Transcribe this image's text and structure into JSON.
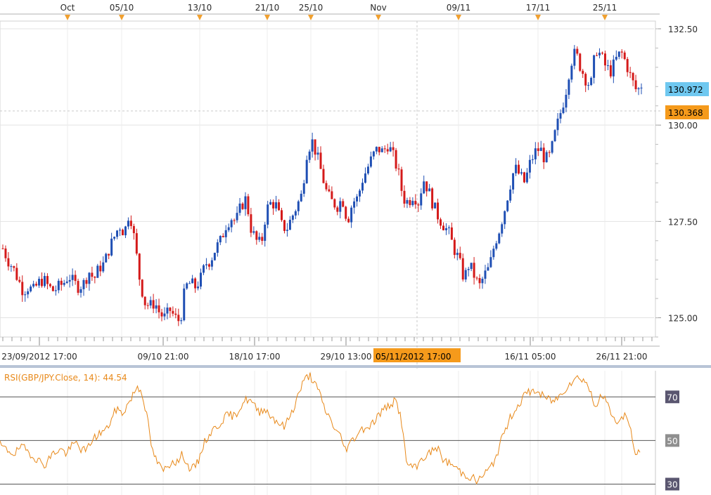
{
  "chart_data": [
    {
      "type": "candlestick",
      "symbol": "GBP/JPY",
      "ylim": [
        124.5,
        132.7
      ],
      "yticks": [
        "132.50",
        "130.00",
        "127.50",
        "125.00"
      ],
      "ytick_values": [
        132.5,
        130.0,
        127.5,
        125.0
      ],
      "top_date_labels": [
        "Oct",
        "05/10",
        "13/10",
        "21/10",
        "25/10",
        "Nov",
        "09/11",
        "17/11",
        "25/11"
      ],
      "bottom_date_labels": [
        "23/09/2012 17:00",
        "09/10 21:00",
        "18/10 17:00",
        "29/10 13:00",
        "16/11 05:00",
        "26/11 21:00"
      ],
      "last_price": "130.972",
      "crosshair_price": "130.368",
      "crosshair_date": "05/11/2012 17:00",
      "colors": {
        "up": "#1f4fb4",
        "down": "#d41a1a",
        "last_price_badge": "#6fc8f0",
        "crosshair_badge": "#f59a1b"
      },
      "close_path": [
        126.8,
        126.5,
        126.3,
        126.0,
        125.7,
        125.8,
        125.7,
        125.9,
        126.0,
        125.8,
        125.7,
        125.8,
        125.9,
        126.1,
        125.9,
        125.8,
        125.9,
        126.2,
        126.0,
        126.3,
        126.4,
        126.8,
        127.1,
        127.4,
        127.2,
        127.8,
        127.0,
        126.0,
        125.4,
        125.3,
        125.4,
        125.1,
        125.0,
        125.2,
        125.0,
        124.9,
        125.8,
        125.9,
        125.8,
        126.0,
        126.4,
        126.5,
        126.8,
        127.0,
        127.4,
        127.6,
        127.5,
        127.9,
        128.1,
        127.3,
        127.0,
        126.9,
        127.8,
        128.0,
        127.9,
        127.4,
        127.3,
        127.6,
        127.9,
        128.2,
        129.3,
        129.6,
        129.2,
        128.7,
        128.2,
        128.0,
        127.9,
        128.1,
        127.5,
        128.0,
        128.1,
        128.6,
        128.9,
        129.2,
        129.4,
        129.3,
        129.5,
        129.2,
        128.8,
        128.1,
        128.0,
        128.2,
        128.0,
        128.6,
        128.3,
        127.9,
        127.6,
        127.4,
        127.2,
        126.8,
        126.5,
        126.0,
        126.4,
        126.1,
        125.8,
        126.1,
        126.3,
        126.9,
        127.3,
        127.8,
        128.4,
        128.9,
        128.7,
        128.5,
        129.0,
        129.3,
        129.4,
        129.1,
        129.2,
        129.8,
        130.3,
        130.8,
        131.6,
        131.9,
        131.5,
        131.2,
        131.0,
        132.0,
        131.8,
        131.5,
        131.4,
        131.7,
        131.9,
        131.6,
        131.2,
        130.9,
        130.97
      ]
    },
    {
      "type": "line",
      "title": "RSI(GBP/JPY.Close, 14): 44.54",
      "ylim": [
        25,
        82
      ],
      "levels": [
        "70",
        "50",
        "30"
      ],
      "level_values": [
        70,
        50,
        30
      ],
      "colors": {
        "line": "#e8891a",
        "level_badge_70": "#5a5670",
        "level_badge_50": "#8f8f8f",
        "level_badge_30": "#5a5670"
      },
      "values": [
        48,
        46,
        45,
        44,
        47,
        46,
        44,
        42,
        40,
        39,
        43,
        45,
        46,
        44,
        47,
        49,
        46,
        45,
        50,
        52,
        54,
        55,
        60,
        65,
        62,
        66,
        70,
        75,
        72,
        60,
        45,
        40,
        36,
        38,
        41,
        40,
        44,
        38,
        37,
        40,
        48,
        52,
        55,
        57,
        60,
        62,
        61,
        64,
        68,
        69,
        66,
        63,
        65,
        62,
        60,
        58,
        56,
        61,
        66,
        73,
        78,
        80,
        76,
        71,
        64,
        60,
        55,
        52,
        46,
        49,
        52,
        55,
        56,
        57,
        60,
        63,
        65,
        67,
        68,
        60,
        40,
        38,
        37,
        42,
        43,
        45,
        47,
        42,
        40,
        39,
        37,
        35,
        34,
        33,
        31,
        34,
        36,
        39,
        45,
        52,
        58,
        63,
        66,
        70,
        72,
        73,
        72,
        70,
        69,
        68,
        70,
        73,
        76,
        78,
        79,
        78,
        74,
        66,
        69,
        70,
        64,
        60,
        58,
        63,
        56,
        44,
        44.54
      ]
    }
  ]
}
